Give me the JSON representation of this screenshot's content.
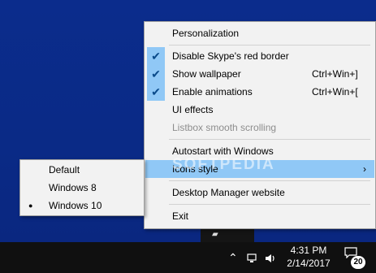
{
  "menu": {
    "personalization": "Personalization",
    "disable_border": "Disable Skype's red border",
    "show_wallpaper": "Show wallpaper",
    "show_wallpaper_shortcut": "Ctrl+Win+]",
    "enable_animations": "Enable animations",
    "enable_animations_shortcut": "Ctrl+Win+[",
    "ui_effects": "UI effects",
    "listbox_smooth": "Listbox smooth scrolling",
    "autostart": "Autostart with Windows",
    "icons_style": "Icons style",
    "website": "Desktop Manager website",
    "exit": "Exit"
  },
  "submenu": {
    "items": [
      "Default",
      "Windows 8",
      "Windows 10"
    ],
    "selected": "Windows 10"
  },
  "watermark": "SOFTPEDIA",
  "taskbar": {
    "time": "4:31 PM",
    "date": "2/14/2017",
    "notification_count": "20"
  },
  "icons": {
    "check": "checkmark-icon",
    "submenu_arrow": "chevron-right-icon",
    "radio": "radio-dot-icon",
    "tray_up": "chevron-up-icon",
    "network": "network-icon",
    "volume": "speaker-icon",
    "notification": "notification-icon"
  },
  "colors": {
    "highlight": "#90c8f6",
    "menu_bg": "#f2f2f2",
    "desktop": "#0a2a8a",
    "taskbar": "#101010"
  }
}
